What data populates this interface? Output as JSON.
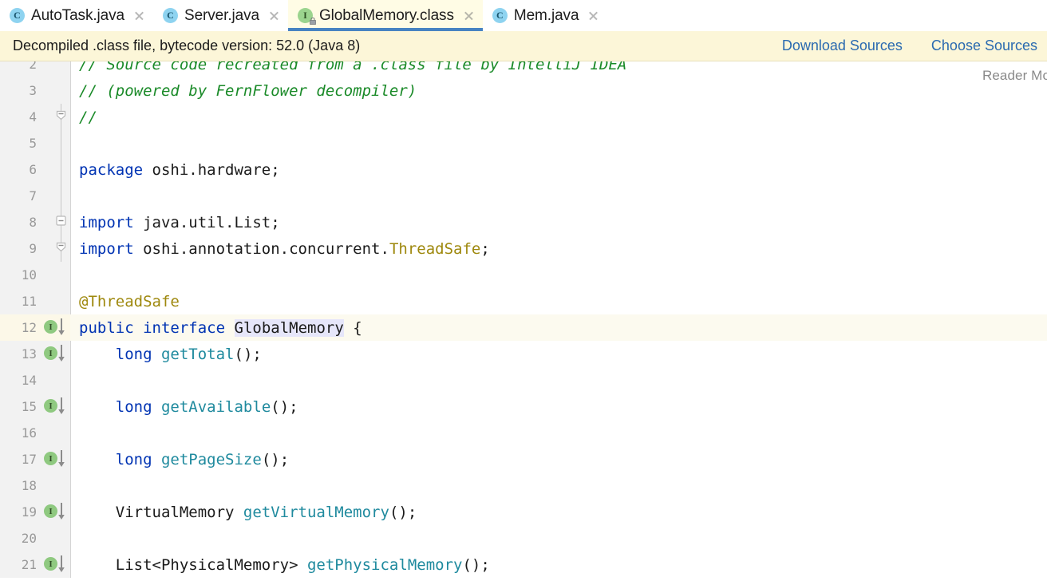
{
  "tabs": [
    {
      "label": "AutoTask.java",
      "icon": "java-class-icon",
      "icon_kind": "cls",
      "icon_letter": "C",
      "active": false,
      "closable": true
    },
    {
      "label": "Server.java",
      "icon": "java-class-icon",
      "icon_kind": "cls",
      "icon_letter": "C",
      "active": false,
      "closable": true
    },
    {
      "label": "GlobalMemory.class",
      "icon": "java-interface-locked-icon",
      "icon_kind": "iface",
      "icon_letter": "I",
      "active": true,
      "closable": true
    },
    {
      "label": "Mem.java",
      "icon": "java-class-icon",
      "icon_kind": "cls",
      "icon_letter": "C",
      "active": false,
      "closable": true
    }
  ],
  "notification": {
    "message": "Decompiled .class file, bytecode version: 52.0 (Java 8)",
    "actions": [
      {
        "label": "Download Sources"
      },
      {
        "label": "Choose Sources"
      }
    ]
  },
  "editor": {
    "reader_mode_label": "Reader Mo",
    "active_line": 12,
    "highlighted_symbol": "GlobalMemory",
    "lines": [
      {
        "n": 2,
        "marker": "none",
        "fold": "none",
        "tokens": [
          {
            "t": "// Source code recreated from a .class file by IntelliJ IDEA",
            "c": "comment"
          }
        ]
      },
      {
        "n": 3,
        "marker": "none",
        "fold": "none",
        "tokens": [
          {
            "t": "// (powered by FernFlower decompiler)",
            "c": "comment"
          }
        ]
      },
      {
        "n": 4,
        "marker": "none",
        "fold": "end",
        "tokens": [
          {
            "t": "//",
            "c": "comment"
          }
        ]
      },
      {
        "n": 5,
        "marker": "none",
        "fold": "none",
        "tokens": []
      },
      {
        "n": 6,
        "marker": "none",
        "fold": "none",
        "tokens": [
          {
            "t": "package",
            "c": "kw"
          },
          {
            "t": " oshi.hardware;",
            "c": "plain"
          }
        ]
      },
      {
        "n": 7,
        "marker": "none",
        "fold": "none",
        "tokens": []
      },
      {
        "n": 8,
        "marker": "none",
        "fold": "start",
        "tokens": [
          {
            "t": "import",
            "c": "kw"
          },
          {
            "t": " java.util.List;",
            "c": "plain"
          }
        ]
      },
      {
        "n": 9,
        "marker": "none",
        "fold": "end",
        "tokens": [
          {
            "t": "import",
            "c": "kw"
          },
          {
            "t": " oshi.annotation.concurrent.",
            "c": "plain"
          },
          {
            "t": "ThreadSafe",
            "c": "anno"
          },
          {
            "t": ";",
            "c": "plain"
          }
        ]
      },
      {
        "n": 10,
        "marker": "none",
        "fold": "none",
        "tokens": []
      },
      {
        "n": 11,
        "marker": "none",
        "fold": "none",
        "tokens": [
          {
            "t": "@ThreadSafe",
            "c": "anno"
          }
        ]
      },
      {
        "n": 12,
        "marker": "impl",
        "fold": "none",
        "caret": true,
        "tokens": [
          {
            "t": "public",
            "c": "kw"
          },
          {
            "t": " ",
            "c": "plain"
          },
          {
            "t": "interface",
            "c": "kw"
          },
          {
            "t": " ",
            "c": "plain"
          },
          {
            "t": "GlobalMemory",
            "c": "plain hl"
          },
          {
            "t": " {",
            "c": "plain"
          }
        ]
      },
      {
        "n": 13,
        "marker": "impl",
        "fold": "none",
        "tokens": [
          {
            "t": "    ",
            "c": "plain"
          },
          {
            "t": "long",
            "c": "kw"
          },
          {
            "t": " ",
            "c": "plain"
          },
          {
            "t": "getTotal",
            "c": "method"
          },
          {
            "t": "();",
            "c": "plain"
          }
        ]
      },
      {
        "n": 14,
        "marker": "none",
        "fold": "none",
        "tokens": []
      },
      {
        "n": 15,
        "marker": "impl",
        "fold": "none",
        "tokens": [
          {
            "t": "    ",
            "c": "plain"
          },
          {
            "t": "long",
            "c": "kw"
          },
          {
            "t": " ",
            "c": "plain"
          },
          {
            "t": "getAvailable",
            "c": "method"
          },
          {
            "t": "();",
            "c": "plain"
          }
        ]
      },
      {
        "n": 16,
        "marker": "none",
        "fold": "none",
        "tokens": []
      },
      {
        "n": 17,
        "marker": "impl",
        "fold": "none",
        "tokens": [
          {
            "t": "    ",
            "c": "plain"
          },
          {
            "t": "long",
            "c": "kw"
          },
          {
            "t": " ",
            "c": "plain"
          },
          {
            "t": "getPageSize",
            "c": "method"
          },
          {
            "t": "();",
            "c": "plain"
          }
        ]
      },
      {
        "n": 18,
        "marker": "none",
        "fold": "none",
        "tokens": []
      },
      {
        "n": 19,
        "marker": "impl",
        "fold": "none",
        "tokens": [
          {
            "t": "    VirtualMemory ",
            "c": "plain"
          },
          {
            "t": "getVirtualMemory",
            "c": "method"
          },
          {
            "t": "();",
            "c": "plain"
          }
        ]
      },
      {
        "n": 20,
        "marker": "none",
        "fold": "none",
        "tokens": []
      },
      {
        "n": 21,
        "marker": "impl",
        "fold": "none",
        "tokens": [
          {
            "t": "    List<PhysicalMemory> ",
            "c": "plain"
          },
          {
            "t": "getPhysicalMemory",
            "c": "method"
          },
          {
            "t": "();",
            "c": "plain"
          }
        ]
      }
    ]
  },
  "colors": {
    "tab_active_bg": "#fffce5",
    "tab_active_underline": "#4783c2",
    "notification_bg": "#fcf6d8",
    "link": "#2a6ab0",
    "comment": "#1a8a28",
    "keyword": "#0033b3",
    "method": "#1f8a9e",
    "annotation": "#9e880d",
    "symbol_highlight": "#e6e6fa",
    "gutter_bg": "#f2f2f2",
    "caret_line_bg": "#fcfaef"
  }
}
